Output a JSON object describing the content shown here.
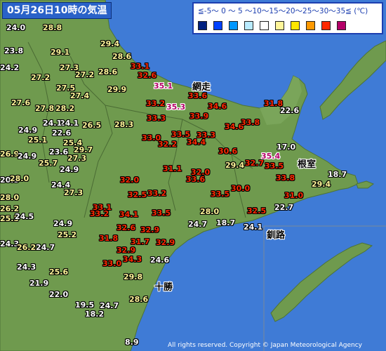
{
  "title": "05月26日10時の気温",
  "legend": {
    "scale_text": "≦-5～ 0 ～ 5 ～10～15～20～25～30～35≦ (℃)",
    "swatch_colors": [
      "#002080",
      "#0041ff",
      "#0096ff",
      "#b9ebff",
      "#ffffff",
      "#fff599",
      "#ffe600",
      "#ff9900",
      "#ff2800",
      "#b40068"
    ]
  },
  "place_labels": {
    "abashiri": "網走",
    "nemuro": "根室",
    "kushiro": "釧路",
    "tokachi": "十勝"
  },
  "copyright": "All rights reserved. Copyright © Japan Meteorological Agency",
  "colors": {
    "sea": "#3f7bd6",
    "land": "#6f9a4e",
    "temp_20_25": "#ffffff",
    "temp_25_30": "#fff599",
    "temp_30_35": "#ff2800",
    "temp_35_plus": "#b40068"
  },
  "temperatures": [
    "24.0",
    "28.8",
    "23.8",
    "29.1",
    "29.4",
    "24.2",
    "28.6",
    "27.2",
    "27.3",
    "27.2",
    "28.6",
    "33.1",
    "32.6",
    "27.5",
    "27.4",
    "29.9",
    "35.1",
    "33.6",
    "27.6",
    "27.8",
    "28.2",
    "33.2",
    "35.3",
    "34.6",
    "31.8",
    "22.6",
    "24.1",
    "22.6",
    "24.1",
    "26.5",
    "28.3",
    "33.3",
    "33.9",
    "34.6",
    "33.8",
    "24.9",
    "25.1",
    "25.4",
    "33.5",
    "33.3",
    "33.0",
    "32.2",
    "34.4",
    "26.9",
    "23.6",
    "29.7",
    "30.6",
    "17.0",
    "24.9",
    "25.7",
    "27.3",
    "29.4",
    "32.7",
    "35.4",
    "33.5",
    "24.9",
    "31.1",
    "32.0",
    "18.7",
    "20.5",
    "28.0",
    "24.4",
    "32.0",
    "33.6",
    "33.8",
    "29.4",
    "27.3",
    "32.5",
    "33.2",
    "33.5",
    "30.0",
    "28.0",
    "26.2",
    "33.1",
    "31.0",
    "25.5",
    "24.5",
    "33.2",
    "34.1",
    "33.5",
    "28.0",
    "32.5",
    "22.7",
    "24.9",
    "24.7",
    "18.7",
    "24.1",
    "25.2",
    "32.6",
    "32.9",
    "24.3",
    "31.8",
    "31.7",
    "32.9",
    "26.2",
    "24.7",
    "32.9",
    "34.3",
    "24.6",
    "33.0",
    "24.3",
    "25.6",
    "21.9",
    "29.8",
    "22.0",
    "28.6",
    "19.5",
    "24.7",
    "18.2",
    "8.9"
  ]
}
